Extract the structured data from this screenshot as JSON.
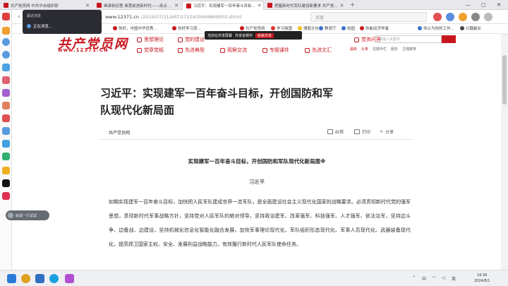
{
  "tabs": [
    {
      "title": "共产党员网 中共中央组织部",
      "color": "#c8161d",
      "active": false
    },
    {
      "title": "继承新征程 奋勇前进新时代——亮点...",
      "color": "#c8161d",
      "active": false
    },
    {
      "title": "习近平：实现建军一百年奋斗目标...",
      "color": "#c8161d",
      "active": true
    },
    {
      "title": "把握新时代军队建设新要求 共产党...",
      "color": "#c8161d",
      "active": false
    }
  ],
  "address": {
    "domain": "www.12371.cn",
    "path": "/2024/07/31/ARTI1722409469869950.shtml",
    "search_placeholder": "百度"
  },
  "bookmarks": [
    {
      "label": "收藏",
      "color": "#f0a030"
    },
    {
      "label": "你好，中国中华优秀...",
      "color": "#c8161d"
    },
    {
      "label": "你好学习资…",
      "color": "#c8161d"
    },
    {
      "label": "共产党员网",
      "color": "#c8161d"
    },
    {
      "label": "学习强国",
      "color": "#e03030"
    },
    {
      "label": "搜狐文化",
      "color": "#f0c020"
    },
    {
      "label": "教育厅",
      "color": "#3a70c8"
    },
    {
      "label": "校园",
      "color": "#3a70c8"
    },
    {
      "label": "你能经济学者",
      "color": "#c8161d"
    },
    {
      "label": "你认为你的工作…",
      "color": "#3a70c8"
    },
    {
      "label": "兴趣副业",
      "color": "#444444"
    }
  ],
  "popup": {
    "header": "最近浏览",
    "label": "正在浏览..."
  },
  "site": {
    "logo": "共产党员网",
    "logo_url": "www.12371.CN",
    "nav_row1": [
      "思想理论",
      "党的建设",
      "时代楷模",
      "党员服务",
      "学习资料",
      "党务问答"
    ],
    "nav_row2": [
      "党章党规",
      "先进典型",
      "观察交流",
      "专题课件",
      "先进文汇"
    ],
    "top_links": [
      "最新",
      "头条",
      "往期专栏",
      "服务",
      "主题教育"
    ],
    "search_placeholder": "请输入关键字"
  },
  "media_bar": {
    "label1": "当前在共享屏幕",
    "label2": "共享音频中",
    "stop_label": "结束共享"
  },
  "article": {
    "headline": "习近平：实现建军一百年奋斗目标，开创国防和军队现代化新局面",
    "source": "共产党员网",
    "actions": [
      "纠错",
      "打印",
      "分享"
    ],
    "subtitle": "实现建军一百年奋斗目标，开创国防和军队现代化新局面※",
    "author": "习近平",
    "body": "如期实现建军一百年奋斗目标，加快把人民军队建成世界一流军队，是全面建设社会主义现代化国家的战略要求。必须贯彻新时代党的强军思想，贯彻新时代军事战略方针，坚持党对人民军队的绝对领导，坚持政治建军、改革强军、科技强军、人才强军、依法治军，坚持边斗争、边备战、边建设，坚持机械化信息化智能化融合发展，加快军事理论现代化、军队组织形态现代化、军事人员现代化、武器装备现代化，提高捍卫国家主权、安全、发展利益战略能力，有效履行新时代人民军队使命任务。"
  },
  "bubble": {
    "label": "就成一行试试"
  },
  "taskbar": {
    "time": "16:30",
    "date": "2024/8/1",
    "ime": "中",
    "lang": "英"
  }
}
